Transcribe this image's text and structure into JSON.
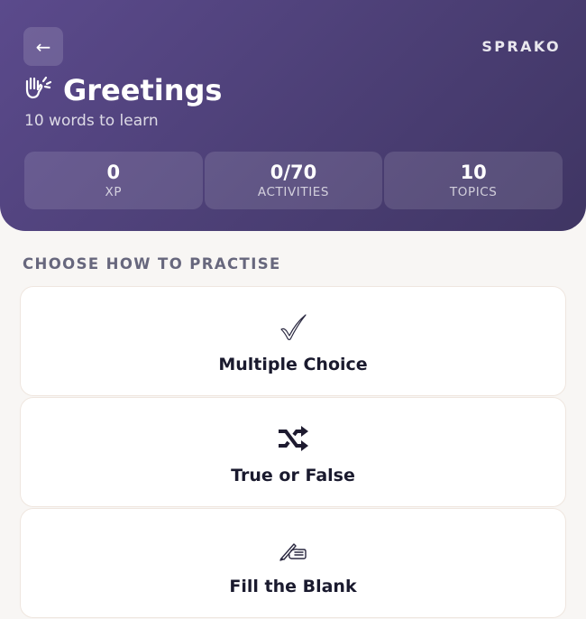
{
  "header": {
    "back_icon": "←",
    "brand": "SPRAKO",
    "title_icon": "🙌",
    "title": "Greetings",
    "subtitle": "10 words to learn",
    "gradient": [
      "#5b4a8c",
      "#3f3563"
    ]
  },
  "stats": [
    {
      "value": "0",
      "label": "XP"
    },
    {
      "value": "0/70",
      "label": "ACTIVITIES"
    },
    {
      "value": "10",
      "label": "TOPICS"
    }
  ],
  "section_title": "CHOOSE HOW TO PRACTISE",
  "modes": [
    {
      "icon": "check-mark-icon",
      "glyph": "✅",
      "label": "Multiple Choice"
    },
    {
      "icon": "shuffle-icon",
      "glyph": "🔀",
      "label": "True or False"
    },
    {
      "icon": "writing-hand-icon",
      "glyph": "✍",
      "label": "Fill the Blank"
    }
  ]
}
